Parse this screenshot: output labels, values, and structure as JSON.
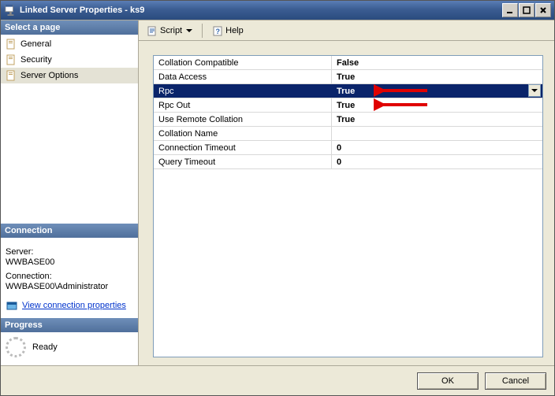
{
  "window": {
    "title": "Linked Server Properties - ks9"
  },
  "sidebar": {
    "select_page_header": "Select a page",
    "items": [
      {
        "label": "General"
      },
      {
        "label": "Security"
      },
      {
        "label": "Server Options"
      }
    ],
    "connection_header": "Connection",
    "server_label": "Server:",
    "server_value": "WWBASE00",
    "connection_label": "Connection:",
    "connection_value": "WWBASE00\\Administrator",
    "view_conn_props": "View connection properties",
    "progress_header": "Progress",
    "progress_state": "Ready"
  },
  "toolbar": {
    "script_label": "Script",
    "help_label": "Help"
  },
  "grid": {
    "rows": [
      {
        "name": "Collation Compatible",
        "value": "False"
      },
      {
        "name": "Data Access",
        "value": "True"
      },
      {
        "name": "Rpc",
        "value": "True"
      },
      {
        "name": "Rpc Out",
        "value": "True"
      },
      {
        "name": "Use Remote Collation",
        "value": "True"
      },
      {
        "name": "Collation Name",
        "value": ""
      },
      {
        "name": "Connection Timeout",
        "value": "0"
      },
      {
        "name": "Query Timeout",
        "value": "0"
      }
    ]
  },
  "buttons": {
    "ok": "OK",
    "cancel": "Cancel"
  }
}
